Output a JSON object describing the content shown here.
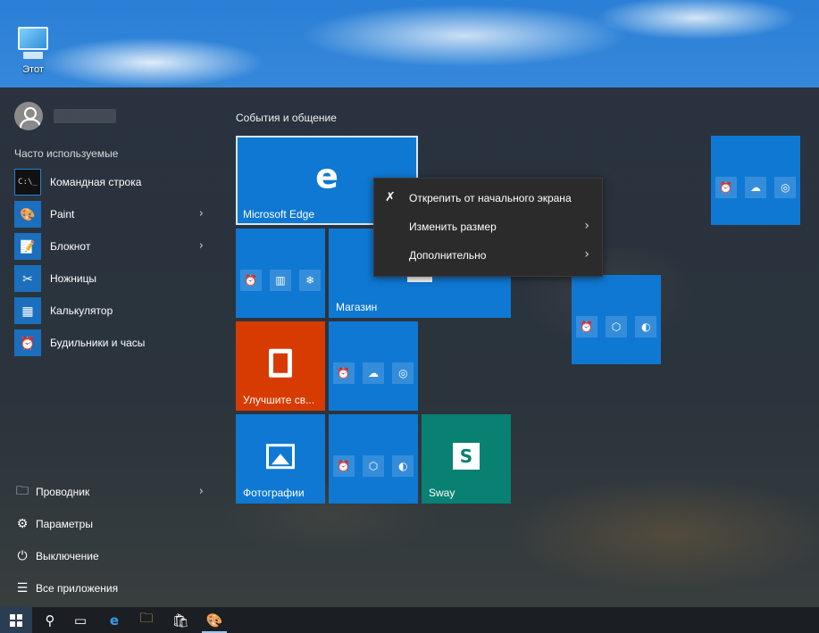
{
  "desktop": {
    "icon_label": "Этот"
  },
  "start_menu": {
    "user": {
      "name": ""
    },
    "most_used_label": "Часто используемые",
    "apps": [
      {
        "label": "Командная строка",
        "icon": "command-prompt-icon",
        "has_submenu": false
      },
      {
        "label": "Paint",
        "icon": "paint-icon",
        "has_submenu": true
      },
      {
        "label": "Блокнот",
        "icon": "notepad-icon",
        "has_submenu": true
      },
      {
        "label": "Ножницы",
        "icon": "snipping-tool-icon",
        "has_submenu": false
      },
      {
        "label": "Калькулятор",
        "icon": "calculator-icon",
        "has_submenu": false
      },
      {
        "label": "Будильники и часы",
        "icon": "alarm-clock-icon",
        "has_submenu": false
      }
    ],
    "bottom": [
      {
        "label": "Проводник",
        "icon": "folder-icon",
        "has_submenu": true
      },
      {
        "label": "Параметры",
        "icon": "gear-icon",
        "has_submenu": false
      },
      {
        "label": "Выключение",
        "icon": "power-icon",
        "has_submenu": false
      },
      {
        "label": "Все приложения",
        "icon": "list-icon",
        "has_submenu": false
      }
    ]
  },
  "tiles": {
    "group_title": "События и общение",
    "edge": "Microsoft Edge",
    "store": "Магазин",
    "office": "Улучшите св...",
    "photos": "Фотографии",
    "sway": "Sway",
    "colors": {
      "blue": "#0f78d3",
      "orange": "#d83b01",
      "teal": "#088072"
    }
  },
  "context_menu": {
    "items": [
      {
        "label": "Открепить от начального экрана",
        "icon": "unpin-icon",
        "has_submenu": false
      },
      {
        "label": "Изменить размер",
        "has_submenu": true
      },
      {
        "label": "Дополнительно",
        "has_submenu": true
      }
    ]
  },
  "taskbar": {
    "buttons": [
      "start-button",
      "search-icon",
      "task-view-icon",
      "edge-icon",
      "file-explorer-icon",
      "store-icon",
      "paint-icon"
    ]
  }
}
